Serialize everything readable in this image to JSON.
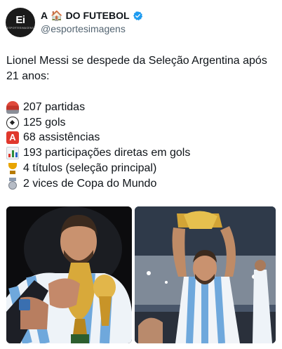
{
  "tweet": {
    "avatar": {
      "mark": "Ei",
      "small": "ESPORTESIMAGENS"
    },
    "author": {
      "name_prefix": "A",
      "name_suffix": "DO FUTEBOL",
      "house_emoji": "🏠",
      "handle": "@esportesimagens",
      "verified": true
    },
    "intro": "Lionel Messi se despede da Seleção Argentina após 21 anos:",
    "stats": [
      {
        "icon": "stadium-icon",
        "text": "207 partidas"
      },
      {
        "icon": "soccer-ball-icon",
        "text": "125 gols"
      },
      {
        "icon": "letter-a-icon",
        "text": "68 assistências"
      },
      {
        "icon": "bar-chart-icon",
        "text": "193 participações diretas em gols"
      },
      {
        "icon": "trophy-icon",
        "text": "4 títulos (seleção principal)"
      },
      {
        "icon": "silver-medal-icon",
        "text": "2 vices de Copa do Mundo"
      }
    ]
  },
  "colors": {
    "text": "#0f1419",
    "handle": "#536471",
    "verified": "#1d9bf0",
    "accent_red": "#e0382d"
  }
}
